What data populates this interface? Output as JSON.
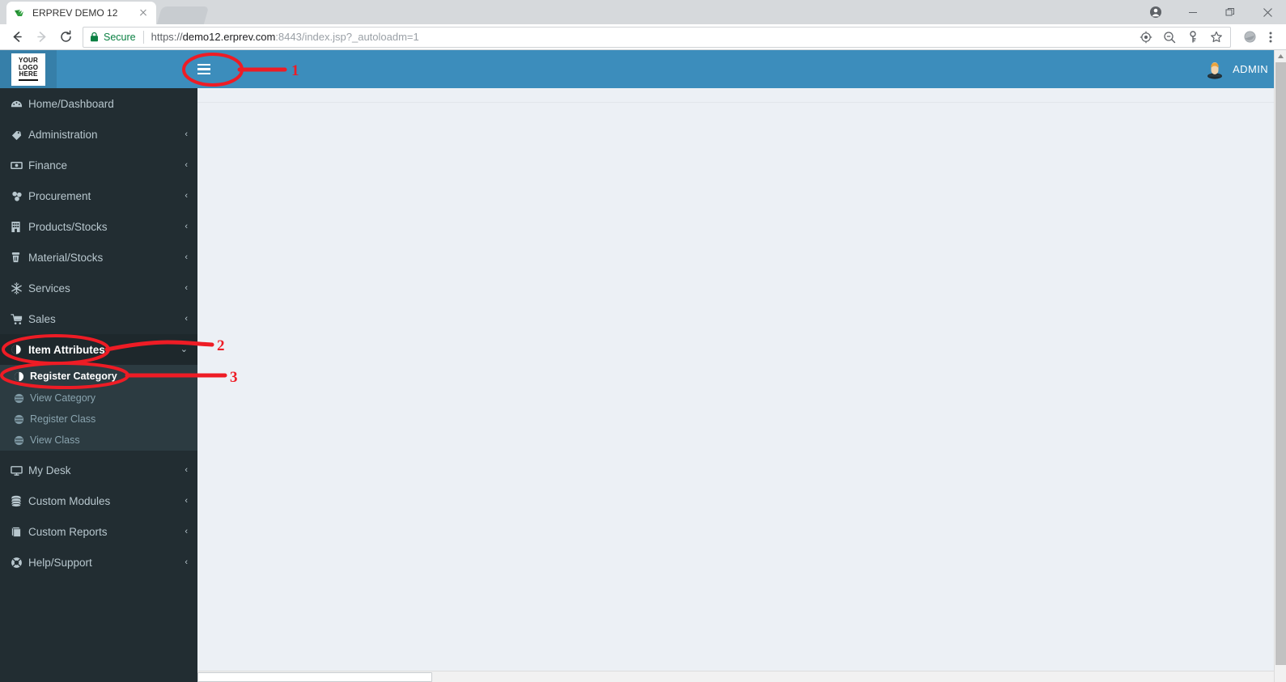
{
  "browser": {
    "tab": {
      "title": "ERPREV DEMO 12",
      "favicon_icon": "green-bird-favicon",
      "close_icon": "close-icon"
    },
    "window_controls": [
      {
        "name": "profile",
        "icon": "user-circle-icon"
      },
      {
        "name": "minimize",
        "icon": "minimize-icon"
      },
      {
        "name": "restore",
        "icon": "restore-icon"
      },
      {
        "name": "close",
        "icon": "close-icon"
      }
    ],
    "nav": {
      "back_icon": "arrow-left-icon",
      "forward_icon": "arrow-right-icon",
      "reload_icon": "reload-icon"
    },
    "omnibox": {
      "security_icon": "lock-icon",
      "security_label": "Secure",
      "url_scheme": "https://",
      "url_host": "demo12.erprev.com",
      "url_rest": ":8443/index.jsp?_autoloadm=1",
      "full_url": "https://demo12.erprev.com:8443/index.jsp?_autoloadm=1"
    },
    "toolbar_icons": [
      {
        "name": "location-target-icon"
      },
      {
        "name": "zoom-out-icon"
      },
      {
        "name": "key-icon"
      },
      {
        "name": "star-bookmark-icon"
      },
      {
        "name": "profile-globe-icon"
      },
      {
        "name": "three-dot-menu-icon"
      }
    ]
  },
  "app": {
    "header": {
      "logo_lines": [
        "YOUR",
        "LOGO",
        "HERE"
      ],
      "menu_toggle_icon": "hamburger-icon",
      "user_icon": "user-avatar-icon",
      "user_label": "ADMIN",
      "bg_color": "#3c8dbc",
      "logo_bg_color": "#367fa9"
    },
    "sidebar": {
      "bg_color": "#222d32",
      "active_bg_color": "#1e282c",
      "submenu_bg_color": "#2c3b41",
      "items": [
        {
          "label": "Home/Dashboard",
          "icon": "dashboard-icon",
          "arrow": "",
          "active": false
        },
        {
          "label": "Administration",
          "icon": "tags-icon",
          "arrow": "‹",
          "active": false
        },
        {
          "label": "Finance",
          "icon": "money-icon",
          "arrow": "‹",
          "active": false
        },
        {
          "label": "Procurement",
          "icon": "sitemap-icon",
          "arrow": "‹",
          "active": false
        },
        {
          "label": "Products/Stocks",
          "icon": "building-icon",
          "arrow": "‹",
          "active": false
        },
        {
          "label": "Material/Stocks",
          "icon": "trash-bin-icon",
          "arrow": "‹",
          "active": false
        },
        {
          "label": "Services",
          "icon": "snowflake-icon",
          "arrow": "‹",
          "active": false
        },
        {
          "label": "Sales",
          "icon": "shopping-cart-icon",
          "arrow": "‹",
          "active": false
        },
        {
          "label": "Item Attributes",
          "icon": "circle-half-icon",
          "arrow": "⌄",
          "active": true
        }
      ],
      "submenu": [
        {
          "label": "Register Category",
          "icon": "circle-bullet-icon",
          "active": true
        },
        {
          "label": "View Category",
          "icon": "circle-bullet-icon",
          "active": false
        },
        {
          "label": "Register Class",
          "icon": "circle-bullet-icon",
          "active": false
        },
        {
          "label": "View Class",
          "icon": "circle-bullet-icon",
          "active": false
        }
      ],
      "items_after": [
        {
          "label": "My Desk",
          "icon": "desktop-icon",
          "arrow": "‹",
          "active": false
        },
        {
          "label": "Custom Modules",
          "icon": "database-icon",
          "arrow": "‹",
          "active": false
        },
        {
          "label": "Custom Reports",
          "icon": "book-icon",
          "arrow": "‹",
          "active": false
        },
        {
          "label": "Help/Support",
          "icon": "lifebuoy-icon",
          "arrow": "‹",
          "active": false
        }
      ]
    },
    "content": {
      "bg_color": "#ecf0f5",
      "body_text": ""
    }
  },
  "annotations": {
    "color": "#ee1c25",
    "markers": [
      {
        "number": "1",
        "target": "hamburger-menu-toggle"
      },
      {
        "number": "2",
        "target": "item-attributes-menu"
      },
      {
        "number": "3",
        "target": "register-category-submenu"
      }
    ]
  }
}
